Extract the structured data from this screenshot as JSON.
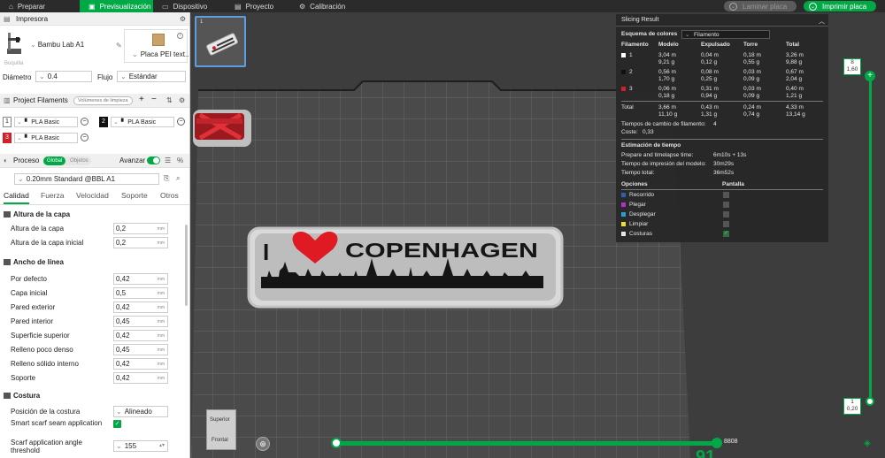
{
  "topbar": {
    "tabs": [
      {
        "label": "Preparar",
        "icon": "home-icon"
      },
      {
        "label": "Previsualización",
        "icon": "preview-icon"
      },
      {
        "label": "Dispositivo",
        "icon": "monitor-icon"
      },
      {
        "label": "Proyecto",
        "icon": "project-icon"
      },
      {
        "label": "Calibración",
        "icon": "calibration-icon"
      }
    ],
    "slice_button": "Laminar placa",
    "print_button": "Imprimir placa",
    "accent": "#00a846"
  },
  "printer": {
    "header": "Impresora",
    "name": "Bambu Lab A1",
    "plate": "Placa PEI text...",
    "caption": "Boquilla",
    "diameter_label": "Diámetro",
    "diameter_value": "0.4",
    "flow_label": "Flujo",
    "flow_value": "Estándar"
  },
  "filaments": {
    "header": "Project Filaments",
    "purge_button": "Volúmenes de limpieza",
    "items": [
      {
        "num": "1",
        "name": "PLA Basic",
        "color": "#ffffff"
      },
      {
        "num": "2",
        "name": "PLA Basic",
        "color": "#111111"
      },
      {
        "num": "3",
        "name": "PLA Basic",
        "color": "#d0202a"
      }
    ]
  },
  "process": {
    "header": "Proceso",
    "global": "Global",
    "objects": "Objetos",
    "advanced": "Avanzar",
    "preset": "0.20mm Standard @BBL A1",
    "tabs": [
      "Calidad",
      "Fuerza",
      "Velocidad",
      "Soporte",
      "Otros"
    ]
  },
  "settings": {
    "layer_title": "Altura de la capa",
    "layer_rows": [
      {
        "label": "Altura de la capa",
        "value": "0,2",
        "unit": "mm"
      },
      {
        "label": "Altura de la capa inicial",
        "value": "0,2",
        "unit": "mm"
      }
    ],
    "width_title": "Ancho de línea",
    "width_rows": [
      {
        "label": "Por defecto",
        "value": "0,42",
        "unit": "mm"
      },
      {
        "label": "Capa inicial",
        "value": "0,5",
        "unit": "mm"
      },
      {
        "label": "Pared exterior",
        "value": "0,42",
        "unit": "mm"
      },
      {
        "label": "Pared interior",
        "value": "0,45",
        "unit": "mm"
      },
      {
        "label": "Superficie superior",
        "value": "0,42",
        "unit": "mm"
      },
      {
        "label": "Relleno poco denso",
        "value": "0,45",
        "unit": "mm"
      },
      {
        "label": "Relleno sólido interno",
        "value": "0,42",
        "unit": "mm"
      },
      {
        "label": "Soporte",
        "value": "0,42",
        "unit": "mm"
      }
    ],
    "seam_title": "Costura",
    "seam_position_label": "Posición de la costura",
    "seam_position_value": "Alineado",
    "scarf_label": "Smart scarf seam application",
    "scarf_angle_label": "Scarf application angle threshold",
    "scarf_angle_value": "155"
  },
  "viewport": {
    "thumb_number": "1",
    "model_text": "I ❤ COPENHAGEN",
    "model_word": "COPENHAGEN",
    "model_i": "I",
    "cube_top": "Superior",
    "cube_front": "Frontal"
  },
  "slicing_result": {
    "title": "Slicing Result",
    "scheme_label": "Esquema de colores",
    "scheme_value": "Filamento",
    "columns": [
      "Filamento",
      "Modelo",
      "Expulsado",
      "Torre",
      "Total"
    ],
    "rows": [
      {
        "id": "1",
        "color": "#ffffff",
        "model": [
          "3,04 m",
          "9,21 g"
        ],
        "flushed": [
          "0,04 m",
          "0,12 g"
        ],
        "tower": [
          "0,18 m",
          "0,55 g"
        ],
        "total": [
          "3,26 m",
          "9,88 g"
        ]
      },
      {
        "id": "2",
        "color": "#111111",
        "model": [
          "0,56 m",
          "1,70 g"
        ],
        "flushed": [
          "0,08 m",
          "0,25 g"
        ],
        "tower": [
          "0,03 m",
          "0,09 g"
        ],
        "total": [
          "0,67 m",
          "2,04 g"
        ]
      },
      {
        "id": "3",
        "color": "#d0202a",
        "model": [
          "0,06 m",
          "0,18 g"
        ],
        "flushed": [
          "0,31 m",
          "0,94 g"
        ],
        "tower": [
          "0,03 m",
          "0,09 g"
        ],
        "total": [
          "0,40 m",
          "1,21 g"
        ]
      }
    ],
    "total_label": "Total",
    "total": {
      "model": [
        "3,66 m",
        "11,10 g"
      ],
      "flushed": [
        "0,43 m",
        "1,31 g"
      ],
      "tower": [
        "0,24 m",
        "0,74 g"
      ],
      "total": [
        "4,33 m",
        "13,14 g"
      ]
    },
    "changes_label": "Tiempos de cambio de filamento:",
    "changes_value": "4",
    "cost_label": "Coste:",
    "cost_value": "0,33",
    "time_title": "Estimación de tiempo",
    "prepare_label": "Prepare and timelapse time:",
    "prepare_value": "6m10s + 13s",
    "model_time_label": "Tiempo de impresión del modelo:",
    "model_time_value": "30m29s",
    "total_time_label": "Tiempo total:",
    "total_time_value": "36m52s",
    "options_label": "Opciones",
    "display_label": "Pantalla",
    "options": [
      {
        "label": "Recorrido",
        "color": "#2c5fb0"
      },
      {
        "label": "Plegar",
        "color": "#b030c8"
      },
      {
        "label": "Desplegar",
        "color": "#2a9fd0"
      },
      {
        "label": "Limpiar",
        "color": "#e8e030"
      },
      {
        "label": "Costuras",
        "color": "#e6e6e6"
      }
    ]
  },
  "layers": {
    "top_layer": "8",
    "top_height": "1,60",
    "bottom_layer": "1",
    "bottom_height": "0,20",
    "move_value": "8808",
    "big_number": "91"
  }
}
